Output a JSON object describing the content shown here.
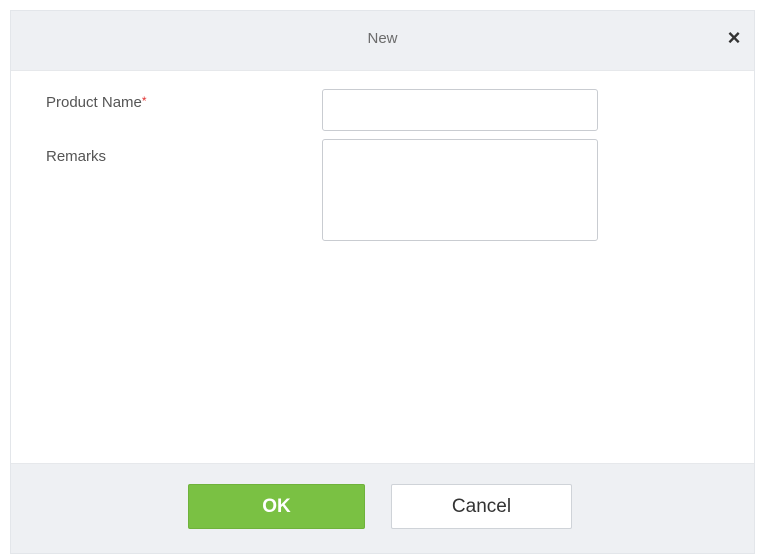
{
  "dialog": {
    "title": "New",
    "close_symbol": "×"
  },
  "form": {
    "product_name": {
      "label": "Product Name",
      "required_marker": "*",
      "value": ""
    },
    "remarks": {
      "label": "Remarks",
      "value": ""
    }
  },
  "footer": {
    "ok_label": "OK",
    "cancel_label": "Cancel"
  },
  "colors": {
    "ok_button": "#7ac143",
    "required_marker": "#e03131",
    "header_bg": "#eef0f3"
  }
}
